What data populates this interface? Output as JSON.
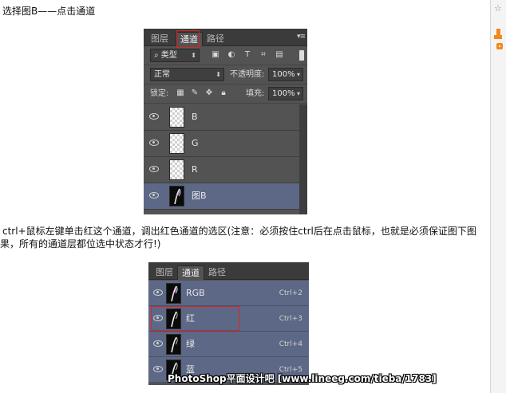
{
  "article": {
    "step_title": "选择图B——点击通道",
    "instruction_line1": "ctrl+鼠标左键单击红这个通道，调出红色通道的选区(注意：必须按住ctrl后在点击鼠标，也就是必须保证图下图",
    "instruction_line2": "果，所有的通道层都位选中状态才行!)"
  },
  "panel1": {
    "tabs": [
      "图层",
      "通道",
      "路径"
    ],
    "active_tab": "通道",
    "filter_label": "类型",
    "blend_mode": "正常",
    "opacity_label": "不透明度:",
    "opacity_value": "100%",
    "lock_label": "锁定:",
    "fill_label": "填充:",
    "fill_value": "100%",
    "layers": [
      {
        "name": "B",
        "thumb": "transparent"
      },
      {
        "name": "G",
        "thumb": "transparent"
      },
      {
        "name": "R",
        "thumb": "transparent"
      },
      {
        "name": "图B",
        "thumb": "image",
        "selected": true
      }
    ]
  },
  "panel2": {
    "tabs": [
      "图层",
      "通道",
      "路径"
    ],
    "active_tab": "通道",
    "channels": [
      {
        "name": "RGB",
        "shortcut": "Ctrl+2"
      },
      {
        "name": "红",
        "shortcut": "Ctrl+3"
      },
      {
        "name": "绿",
        "shortcut": "Ctrl+4"
      },
      {
        "name": "蓝",
        "shortcut": "Ctrl+5"
      }
    ]
  },
  "watermark": "PhotoShop平面设计吧 [www.lineeg.com/tieba/1783]",
  "colors": {
    "panel_bg": "#535353",
    "selected_row": "#5d6886",
    "highlight_box": "#e0221f",
    "accent_orange": "#f08a1c"
  },
  "icons": [
    "search-icon",
    "image-filter-icon",
    "circle-filter-icon",
    "text-filter-icon",
    "transform-filter-icon",
    "smart-object-filter-icon",
    "lock-pixels-icon",
    "brush-icon",
    "move-icon",
    "lock-icon",
    "eye-icon",
    "panel-menu-icon",
    "star-icon"
  ]
}
